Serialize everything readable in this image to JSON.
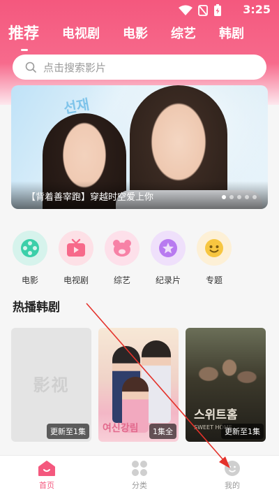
{
  "status_bar": {
    "time": "3:25"
  },
  "tabs": [
    {
      "label": "推荐",
      "active": true
    },
    {
      "label": "电视剧",
      "active": false
    },
    {
      "label": "电影",
      "active": false
    },
    {
      "label": "综艺",
      "active": false
    },
    {
      "label": "韩剧",
      "active": false
    }
  ],
  "search": {
    "placeholder": "点击搜索影片"
  },
  "banner": {
    "caption": "【背着善宰跑】穿越时空爱上你",
    "art_text": "선재",
    "slide_count": 5,
    "active_index": 0
  },
  "categories": [
    {
      "label": "电影",
      "icon": "film-reel-icon",
      "bg": "#d6f3ec",
      "fg": "#3ccfa9"
    },
    {
      "label": "电视剧",
      "icon": "tv-icon",
      "bg": "#fde0e6",
      "fg": "#f7698a"
    },
    {
      "label": "综艺",
      "icon": "bear-icon",
      "bg": "#fde0ea",
      "fg": "#f781a6"
    },
    {
      "label": "纪录片",
      "icon": "star-icon",
      "bg": "#efe0fb",
      "fg": "#b87af0"
    },
    {
      "label": "专题",
      "icon": "smiley-icon",
      "bg": "#fdf0d6",
      "fg": "#f7c640"
    }
  ],
  "section": {
    "title": "热播韩剧"
  },
  "posters": [
    {
      "placeholder_text": "影视",
      "badge": "更新至1集",
      "title": ""
    },
    {
      "art_text": "여신강림",
      "badge": "1集全",
      "title": ""
    },
    {
      "art_text": "스위트홈",
      "art_subtext": "SWEET HOME",
      "badge": "更新至1集",
      "title": ""
    }
  ],
  "navbar": [
    {
      "label": "首页",
      "icon": "home-icon",
      "active": true
    },
    {
      "label": "分类",
      "icon": "grid-icon",
      "active": false
    },
    {
      "label": "我的",
      "icon": "profile-icon",
      "active": false
    }
  ],
  "colors": {
    "brand": "#f4587e",
    "muted": "#9a9a9a"
  }
}
